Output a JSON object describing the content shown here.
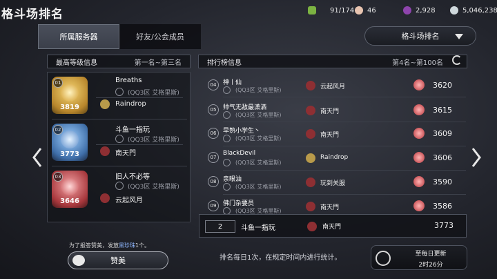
{
  "header": {
    "title": "格斗场排名",
    "resources": [
      {
        "icon": "stamina-icon",
        "value": "91/174",
        "color": "#7cb342"
      },
      {
        "icon": "pearl-icon",
        "value": "46",
        "color": "#e8c4b0"
      },
      {
        "icon": "purple-gem-icon",
        "value": "2,928",
        "color": "#8e44ad"
      },
      {
        "icon": "silver-coin-icon",
        "value": "5,046,238",
        "color": "#cfd8dc"
      }
    ]
  },
  "tabs": [
    {
      "label": "所属服务器",
      "active": true
    },
    {
      "label": "好友/公会成员",
      "active": false
    }
  ],
  "dropdown": {
    "selected": "格斗场排名"
  },
  "left_panel": {
    "title": "最高等级信息",
    "range": "第一名~第三名",
    "entries": [
      {
        "rank": "01",
        "score": "3819",
        "name": "Breaths",
        "server": "(QQ3区 艾格里斯)",
        "guild": "Raindrop",
        "color": "#d4a23a"
      },
      {
        "rank": "02",
        "score": "3773",
        "name": "斗鱼一指玩",
        "server": "(QQ3区 艾格里斯)",
        "guild": "南天門",
        "color": "#4a7bb8"
      },
      {
        "rank": "03",
        "score": "3646",
        "name": "旧人不必等",
        "server": "(QQ3区 艾格里斯)",
        "guild": "云起风月",
        "color": "#b8454a"
      }
    ]
  },
  "right_panel": {
    "title": "排行榜信息",
    "range": "第4名~第100名",
    "rows": [
      {
        "rank": "04",
        "name": "神丨仙",
        "server": "(QQ3区 艾格里斯)",
        "guild": "云起风月",
        "score": "3620"
      },
      {
        "rank": "05",
        "name": "帅气无敌最潇洒",
        "server": "(QQ3区 艾格里斯)",
        "guild": "南天門",
        "score": "3615"
      },
      {
        "rank": "06",
        "name": "早熟小学生丶",
        "server": "(QQ3区 艾格里斯)",
        "guild": "南天門",
        "score": "3609"
      },
      {
        "rank": "07",
        "name": "BlackDevil",
        "server": "(QQ3区 艾格里斯)",
        "guild": "Raindrop",
        "score": "3606"
      },
      {
        "rank": "08",
        "name": "亲眼油",
        "server": "(QQ3区 艾格里斯)",
        "guild": "玩到关服",
        "score": "3590"
      },
      {
        "rank": "09",
        "name": "佛门杂要员",
        "server": "(QQ3区 艾格里斯)",
        "guild": "南天門",
        "score": "3586"
      }
    ]
  },
  "my_rank": {
    "rank": "2",
    "name": "斗鱼一指玩",
    "guild": "南天門",
    "score": "3773"
  },
  "praise": {
    "text_prefix": "为了报答赞美，发放",
    "text_highlight": "黑珍珠",
    "text_suffix": "1个。",
    "button_label": "赞美"
  },
  "notice": "排名每日1次，在规定时间内进行统计。",
  "timer": {
    "label": "至每日更新",
    "value": "2时26分"
  }
}
